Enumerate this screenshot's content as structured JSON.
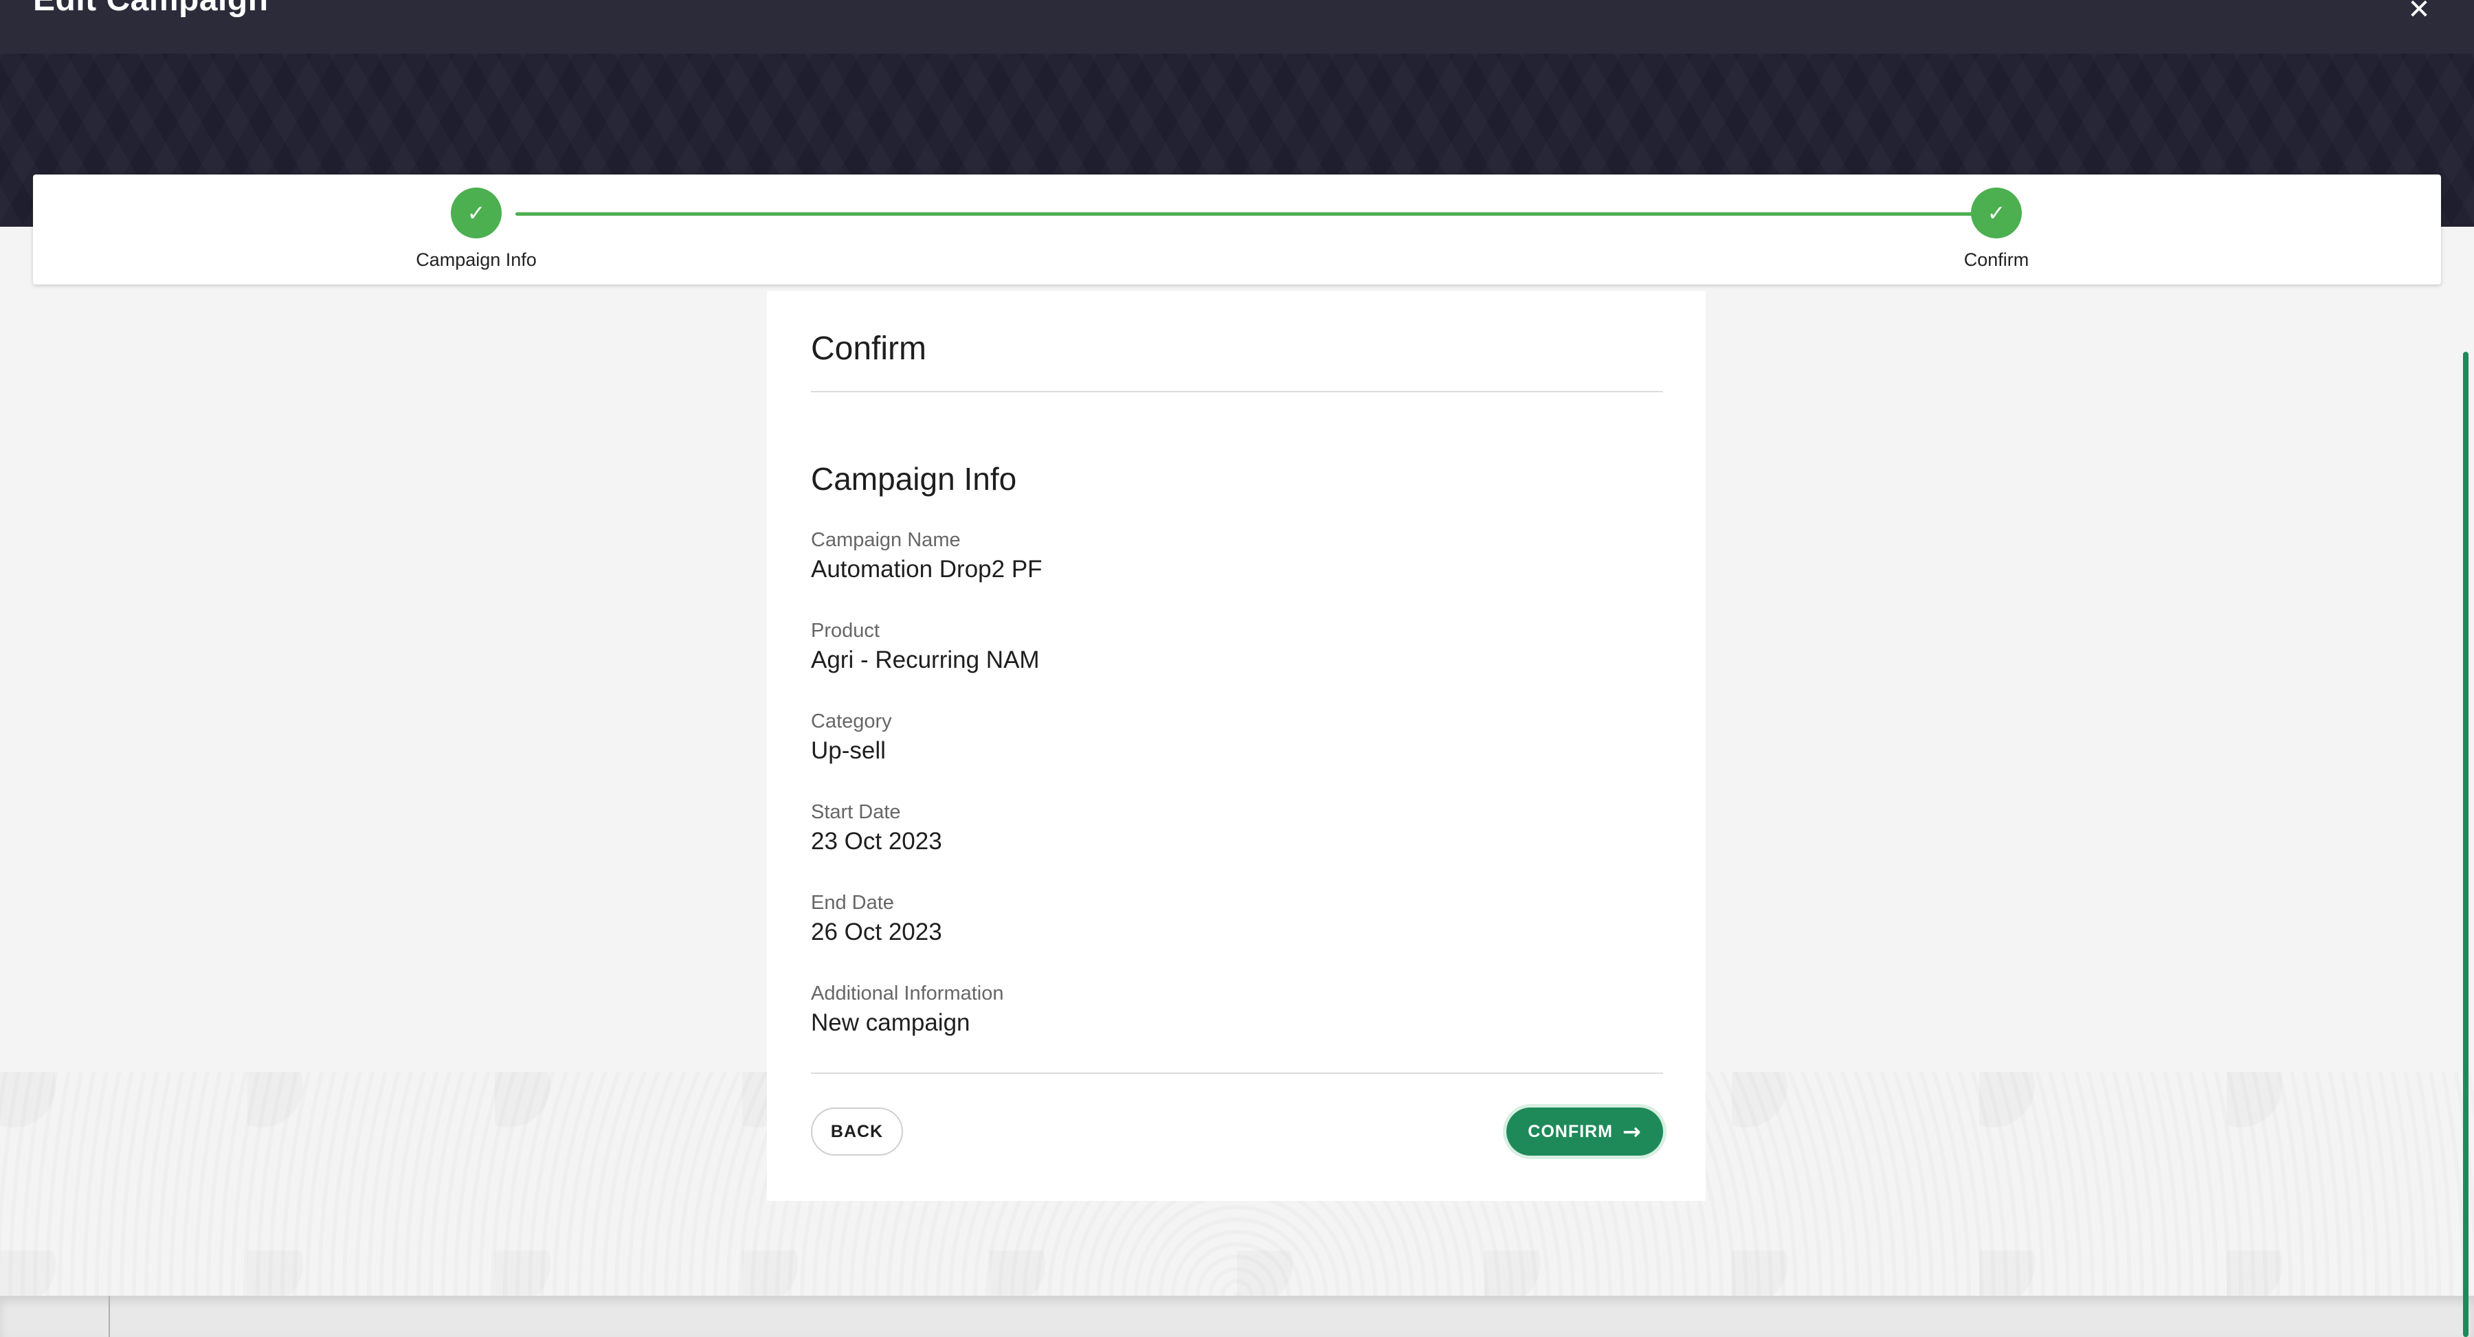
{
  "header": {
    "title": "Edit Campaign",
    "close_icon": "close-icon",
    "close_glyph": "✕"
  },
  "stepper": {
    "steps": [
      {
        "label": "Campaign Info",
        "status": "complete",
        "icon": "check-icon",
        "glyph": "✓"
      },
      {
        "label": "Confirm",
        "status": "complete",
        "icon": "check-icon",
        "glyph": "✓"
      }
    ],
    "accent_color": "#4caf50"
  },
  "card": {
    "title": "Confirm",
    "section_title": "Campaign Info",
    "fields": [
      {
        "label": "Campaign Name",
        "value": "Automation Drop2 PF"
      },
      {
        "label": "Product",
        "value": "Agri - Recurring NAM"
      },
      {
        "label": "Category",
        "value": "Up-sell"
      },
      {
        "label": "Start Date",
        "value": "23 Oct 2023"
      },
      {
        "label": "End Date",
        "value": "26 Oct 2023"
      },
      {
        "label": "Additional Information",
        "value": "New campaign"
      }
    ],
    "back_label": "BACK",
    "confirm_label": "CONFIRM",
    "confirm_icon": "arrow-right-icon",
    "confirm_glyph": "→",
    "confirm_color": "#1e8a5a"
  }
}
